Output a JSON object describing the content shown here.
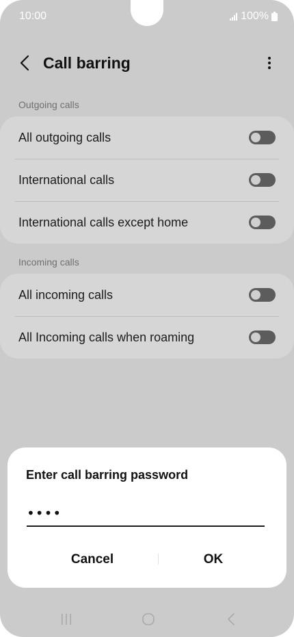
{
  "status": {
    "time": "10:00",
    "battery": "100%"
  },
  "appbar": {
    "title": "Call barring"
  },
  "sections": {
    "outgoing": {
      "label": "Outgoing calls",
      "items": [
        {
          "label": "All outgoing calls"
        },
        {
          "label": "International calls"
        },
        {
          "label": "International calls except home"
        }
      ]
    },
    "incoming": {
      "label": "Incoming calls",
      "items": [
        {
          "label": "All incoming calls"
        },
        {
          "label": "All Incoming calls when roaming"
        }
      ]
    }
  },
  "dialog": {
    "title": "Enter call barring password",
    "password_value": "••••",
    "cancel_label": "Cancel",
    "ok_label": "OK"
  },
  "colors": {
    "background": "#cbcbcb",
    "card": "#d6d6d6",
    "toggle_off": "#5c5c5c",
    "dialog": "#ffffff"
  }
}
